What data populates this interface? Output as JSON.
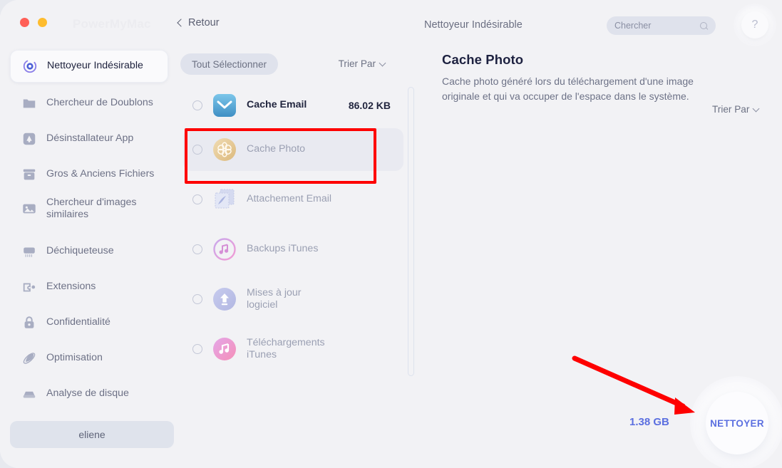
{
  "window": {
    "brand": "PowerMyMac",
    "back_label": "Retour",
    "center_title": "Nettoyeur Indésirable",
    "help_label": "?",
    "traffic_lights": [
      "close-red",
      "minimize-yellow"
    ]
  },
  "search": {
    "placeholder": "Chercher",
    "value": "",
    "icon": "search-icon"
  },
  "sidebar": {
    "items": [
      {
        "label": "Nettoyeur Indésirable",
        "icon": "junk-cleaner-icon",
        "active": true
      },
      {
        "label": "Chercheur de Doublons",
        "icon": "folder-icon",
        "active": false
      },
      {
        "label": "Désinstallateur App",
        "icon": "app-uninstaller-icon",
        "active": false
      },
      {
        "label": "Gros & Anciens Fichiers",
        "icon": "archive-box-icon",
        "active": false
      },
      {
        "label": "Chercheur d'images similaires",
        "icon": "photo-icon",
        "active": false
      },
      {
        "label": "Déchiqueteuse",
        "icon": "shredder-icon",
        "active": false
      },
      {
        "label": "Extensions",
        "icon": "puzzle-piece-icon",
        "active": false
      },
      {
        "label": "Confidentialité",
        "icon": "lock-icon",
        "active": false
      },
      {
        "label": "Optimisation",
        "icon": "rocket-icon",
        "active": false
      },
      {
        "label": "Analyse de disque",
        "icon": "disk-icon",
        "active": false
      }
    ],
    "user_button": "eliene"
  },
  "middle": {
    "select_all_label": "Tout Sélectionner",
    "sort_label": "Trier Par",
    "sort_icon": "chevron-down-icon",
    "rows": [
      {
        "label": "Cache Email",
        "size": "86.02 KB",
        "icon": "mail-icon",
        "checked": false,
        "selected": false,
        "highlighted": false
      },
      {
        "label": "Cache Photo",
        "size": "",
        "icon": "photos-flower-icon",
        "checked": false,
        "selected": true,
        "highlighted": true
      },
      {
        "label": "Attachement Email",
        "size": "",
        "icon": "stamp-icon",
        "checked": false,
        "selected": false,
        "highlighted": false
      },
      {
        "label": "Backups iTunes",
        "size": "",
        "icon": "itunes-circle-icon",
        "checked": false,
        "selected": false,
        "highlighted": false
      },
      {
        "label": "Mises à jour logiciel",
        "size": "",
        "icon": "software-update-icon",
        "checked": false,
        "selected": false,
        "highlighted": false
      },
      {
        "label": "Téléchargements iTunes",
        "size": "",
        "icon": "itunes-download-icon",
        "checked": false,
        "selected": false,
        "highlighted": false
      }
    ]
  },
  "detail": {
    "title": "Cache Photo",
    "description": "Cache photo généré lors du téléchargement d'une image originale et qui va occuper de l'espace dans le système.",
    "sort_label": "Trier Par",
    "sort_icon": "chevron-down-icon"
  },
  "footer": {
    "total_size": "1.38 GB",
    "clean_button": "NETTOYER"
  },
  "annotations": {
    "highlight_color": "#fe0000",
    "arrow_color": "#fe0000",
    "highlight_target": "Cache Photo",
    "arrow_target": "NETTOYER"
  }
}
